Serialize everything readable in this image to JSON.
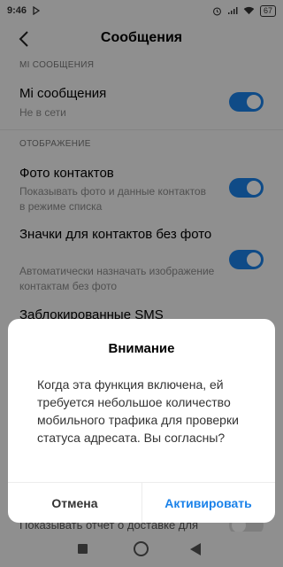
{
  "status_bar": {
    "time": "9:46",
    "battery": "67"
  },
  "header": {
    "title": "Сообщения"
  },
  "sections": [
    {
      "header": "MI СООБЩЕНИЯ",
      "rows": [
        {
          "title": "Mi сообщения",
          "subtitle": "Не в сети",
          "toggle": true
        }
      ]
    },
    {
      "header": "ОТОБРАЖЕНИЕ",
      "rows": [
        {
          "title": "Фото контактов",
          "subtitle": "Показывать фото и данные контактов в режиме списка",
          "toggle": true
        },
        {
          "title": "Значки для контактов без фото",
          "subtitle": "Автоматически назначать изображение контактам без фото",
          "toggle": true
        },
        {
          "title": "Заблокированные SMS"
        }
      ]
    }
  ],
  "partial_row": {
    "title": "Показывать отчет о доставке для",
    "toggle": false
  },
  "dialog": {
    "title": "Внимание",
    "message": "Когда эта функция включена, ей требуется небольшое количество мобильного трафика для проверки статуса адресата. Вы согласны?",
    "cancel_label": "Отмена",
    "confirm_label": "Активировать"
  },
  "colors": {
    "accent": "#1b82e9"
  },
  "icons": [
    "back-arrow-icon",
    "nav-recents-icon",
    "nav-home-icon",
    "nav-back-icon",
    "alarm-icon",
    "wifi-icon",
    "battery-icon"
  ]
}
